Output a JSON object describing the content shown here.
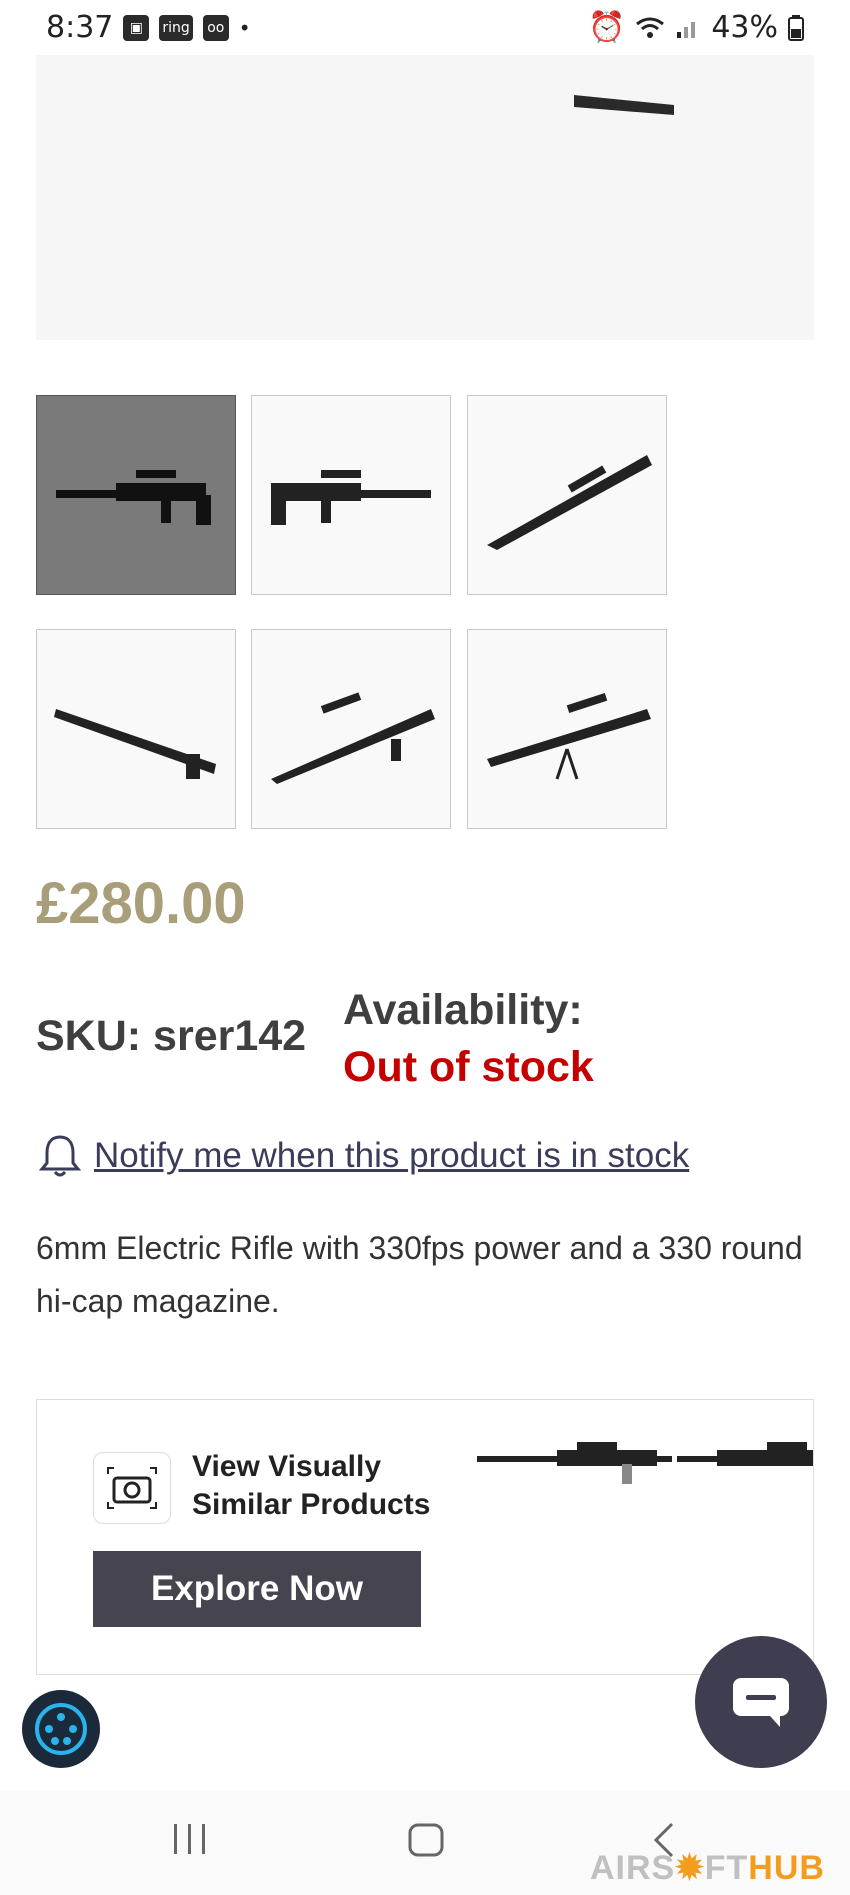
{
  "status_bar": {
    "time": "8:37",
    "notif_icons": [
      "image-icon",
      "ring-icon",
      "voicemail-icon"
    ],
    "ring_label": "ring",
    "dot": "•",
    "battery": "43%"
  },
  "gallery": {
    "thumbnails": [
      {
        "name": "thumb-1",
        "active": true
      },
      {
        "name": "thumb-2",
        "active": false
      },
      {
        "name": "thumb-3",
        "active": false
      },
      {
        "name": "thumb-4",
        "active": false
      },
      {
        "name": "thumb-5",
        "active": false
      },
      {
        "name": "thumb-6",
        "active": false
      }
    ]
  },
  "product": {
    "price": "£280.00",
    "sku": "SKU: srer142",
    "availability_label": "Availability:",
    "availability_value": "Out of stock",
    "notify_text": "Notify me when this product is in stock",
    "description": "6mm Electric Rifle with 330fps power and a 330 round hi-cap magazine."
  },
  "visual_search": {
    "line1": "View Visually",
    "line2": "Similar Products",
    "button": "Explore Now"
  },
  "watermark": {
    "part1": "AIRS",
    "part2": "FT",
    "part3": "HUB"
  },
  "colors": {
    "price": "#a89e7a",
    "out_of_stock": "#c40000",
    "button_bg": "#46444f",
    "chat_bg": "#3f3d50"
  }
}
